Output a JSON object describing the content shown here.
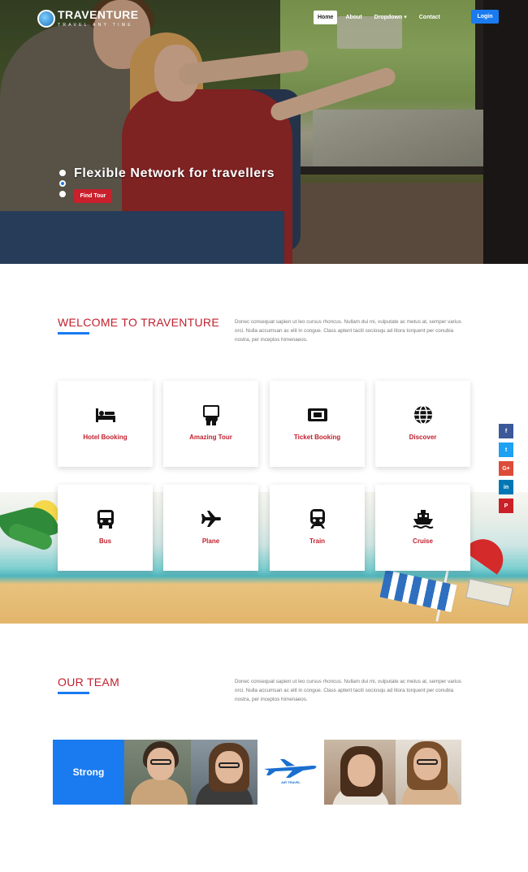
{
  "header": {
    "brand": "TRAVENTURE",
    "tagline": "TRAVEL ANY TIME",
    "nav": [
      {
        "label": "Home"
      },
      {
        "label": "About"
      },
      {
        "label": "Dropdown"
      },
      {
        "label": "Contact"
      }
    ],
    "login_label": "Login"
  },
  "hero": {
    "title": "Flexible Network for travellers",
    "button_label": "Find Tour",
    "slides_count": 3,
    "active_slide": 2
  },
  "welcome": {
    "title": "WELCOME TO TRAVENTURE",
    "text": "Donec consequat sapien ut leo cursus rhoncus. Nullam dui mi, vulputate ac metus at, semper varius orci. Nulla accumsan ac elit in congue. Class aptent taciti sociosqu ad litora torquent per conubia nostra, per inceptos himenaeos."
  },
  "services": [
    {
      "label": "Hotel Booking",
      "icon": "bed-icon"
    },
    {
      "label": "Amazing Tour",
      "icon": "tour-icon"
    },
    {
      "label": "Ticket Booking",
      "icon": "ticket-icon"
    },
    {
      "label": "Discover",
      "icon": "globe-icon"
    },
    {
      "label": "Bus",
      "icon": "bus-icon"
    },
    {
      "label": "Plane",
      "icon": "plane-icon"
    },
    {
      "label": "Train",
      "icon": "train-icon"
    },
    {
      "label": "Cruise",
      "icon": "ship-icon"
    }
  ],
  "social": [
    {
      "label": "f",
      "color": "#3b5998",
      "icon": "facebook-icon"
    },
    {
      "label": "t",
      "color": "#1da1f2",
      "icon": "twitter-icon"
    },
    {
      "label": "G+",
      "color": "#dd4b39",
      "icon": "google-plus-icon"
    },
    {
      "label": "in",
      "color": "#0077b5",
      "icon": "linkedin-icon"
    },
    {
      "label": "P",
      "color": "#cb2027",
      "icon": "pinterest-icon"
    }
  ],
  "team": {
    "title": "OUR TEAM",
    "text": "Donec consequat sapien ut leo cursus rhoncus. Nullam dui mi, vulputate ac metus at, semper varius orci. Nulla accumsan ac elit in congue. Class aptent taciti sociosqu ad litora torquent per conubia nostra, per inceptos himenaeos.",
    "strong_label": "Strong",
    "airline_text": "AIR TRAVEL"
  },
  "colors": {
    "accent_red": "#c01f2d",
    "accent_blue": "#1a7bf0"
  }
}
